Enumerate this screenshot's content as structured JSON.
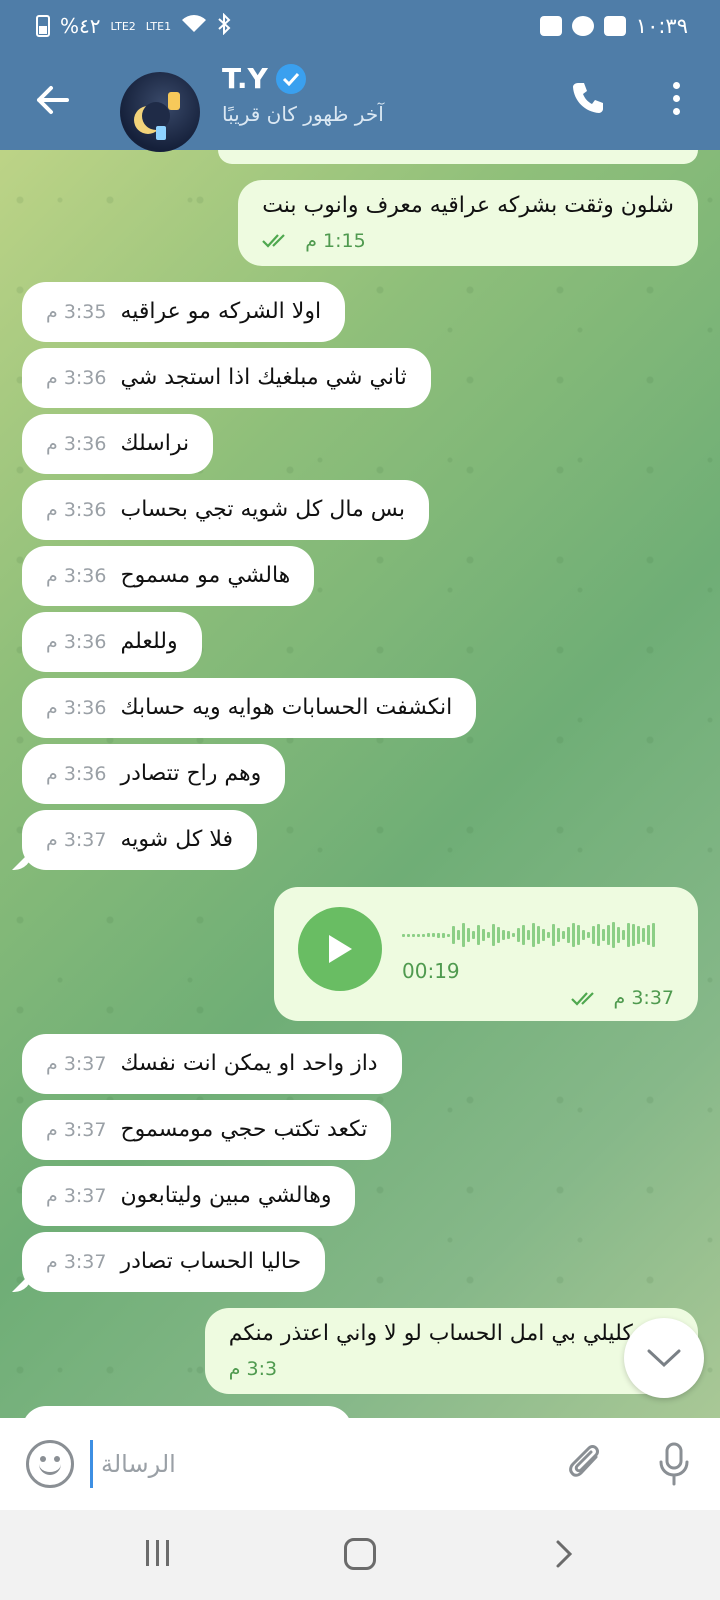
{
  "status_bar": {
    "battery": "%٤٢",
    "sim1": "LTE2",
    "sim2": "LTE1",
    "time": "١٠:٣٩"
  },
  "header": {
    "contact_name": "T.Y",
    "last_seen": "آخر ظهور كان قريبًا"
  },
  "messages": [
    {
      "dir": "out",
      "text": "شلون وثقت بشركه عراقيه معرف وانوب بنت",
      "time": "1:15 م",
      "read": true
    },
    {
      "dir": "in",
      "text": "اولا الشركه مو عراقيه",
      "time": "3:35 م"
    },
    {
      "dir": "in",
      "text": "ثاني شي مبلغيك اذا استجد شي",
      "time": "3:36 م"
    },
    {
      "dir": "in",
      "text": "نراسلك",
      "time": "3:36 م"
    },
    {
      "dir": "in",
      "text": "بس مال كل شويه تجي بحساب",
      "time": "3:36 م"
    },
    {
      "dir": "in",
      "text": "هالشي مو مسموح",
      "time": "3:36 م"
    },
    {
      "dir": "in",
      "text": "وللعلم",
      "time": "3:36 م"
    },
    {
      "dir": "in",
      "text": "انكشفت الحسابات هوايه ويه حسابك",
      "time": "3:36 م"
    },
    {
      "dir": "in",
      "text": "وهم راح تتصادر",
      "time": "3:36 م"
    },
    {
      "dir": "in",
      "text": "فلا كل شويه",
      "time": "3:37 م"
    },
    {
      "dir": "in",
      "text": "داز واحد او يمكن انت نفسك",
      "time": "3:37 م"
    },
    {
      "dir": "in",
      "text": "تكعد تكتب حجي مومسموح",
      "time": "3:37 م"
    },
    {
      "dir": "in",
      "text": "وهالشي مبين وليتابعون",
      "time": "3:37 م"
    },
    {
      "dir": "in",
      "text": "حاليا الحساب تصادر",
      "time": "3:37 م"
    },
    {
      "dir": "out",
      "text": "بس كليلي بي امل الحساب لو لا واني اعتذر منكم",
      "time": "3:3 م",
      "read": false
    }
  ],
  "voice_message": {
    "duration": "00:19",
    "time": "3:37 م",
    "read": true,
    "progress": 0
  },
  "input": {
    "placeholder": "الرسالة"
  },
  "icons": {
    "back": "arrow-left-icon",
    "call": "phone-icon",
    "menu": "more-vertical-icon",
    "emoji": "smiley-icon",
    "attach": "paperclip-icon",
    "mic": "microphone-icon",
    "scroll": "chevron-down-icon"
  },
  "colors": {
    "header": "#4f7da8",
    "outgoing_bubble": "#eefbe0",
    "incoming_bubble": "#ffffff",
    "play_button": "#69bd63",
    "cursor": "#3d8fe3"
  }
}
